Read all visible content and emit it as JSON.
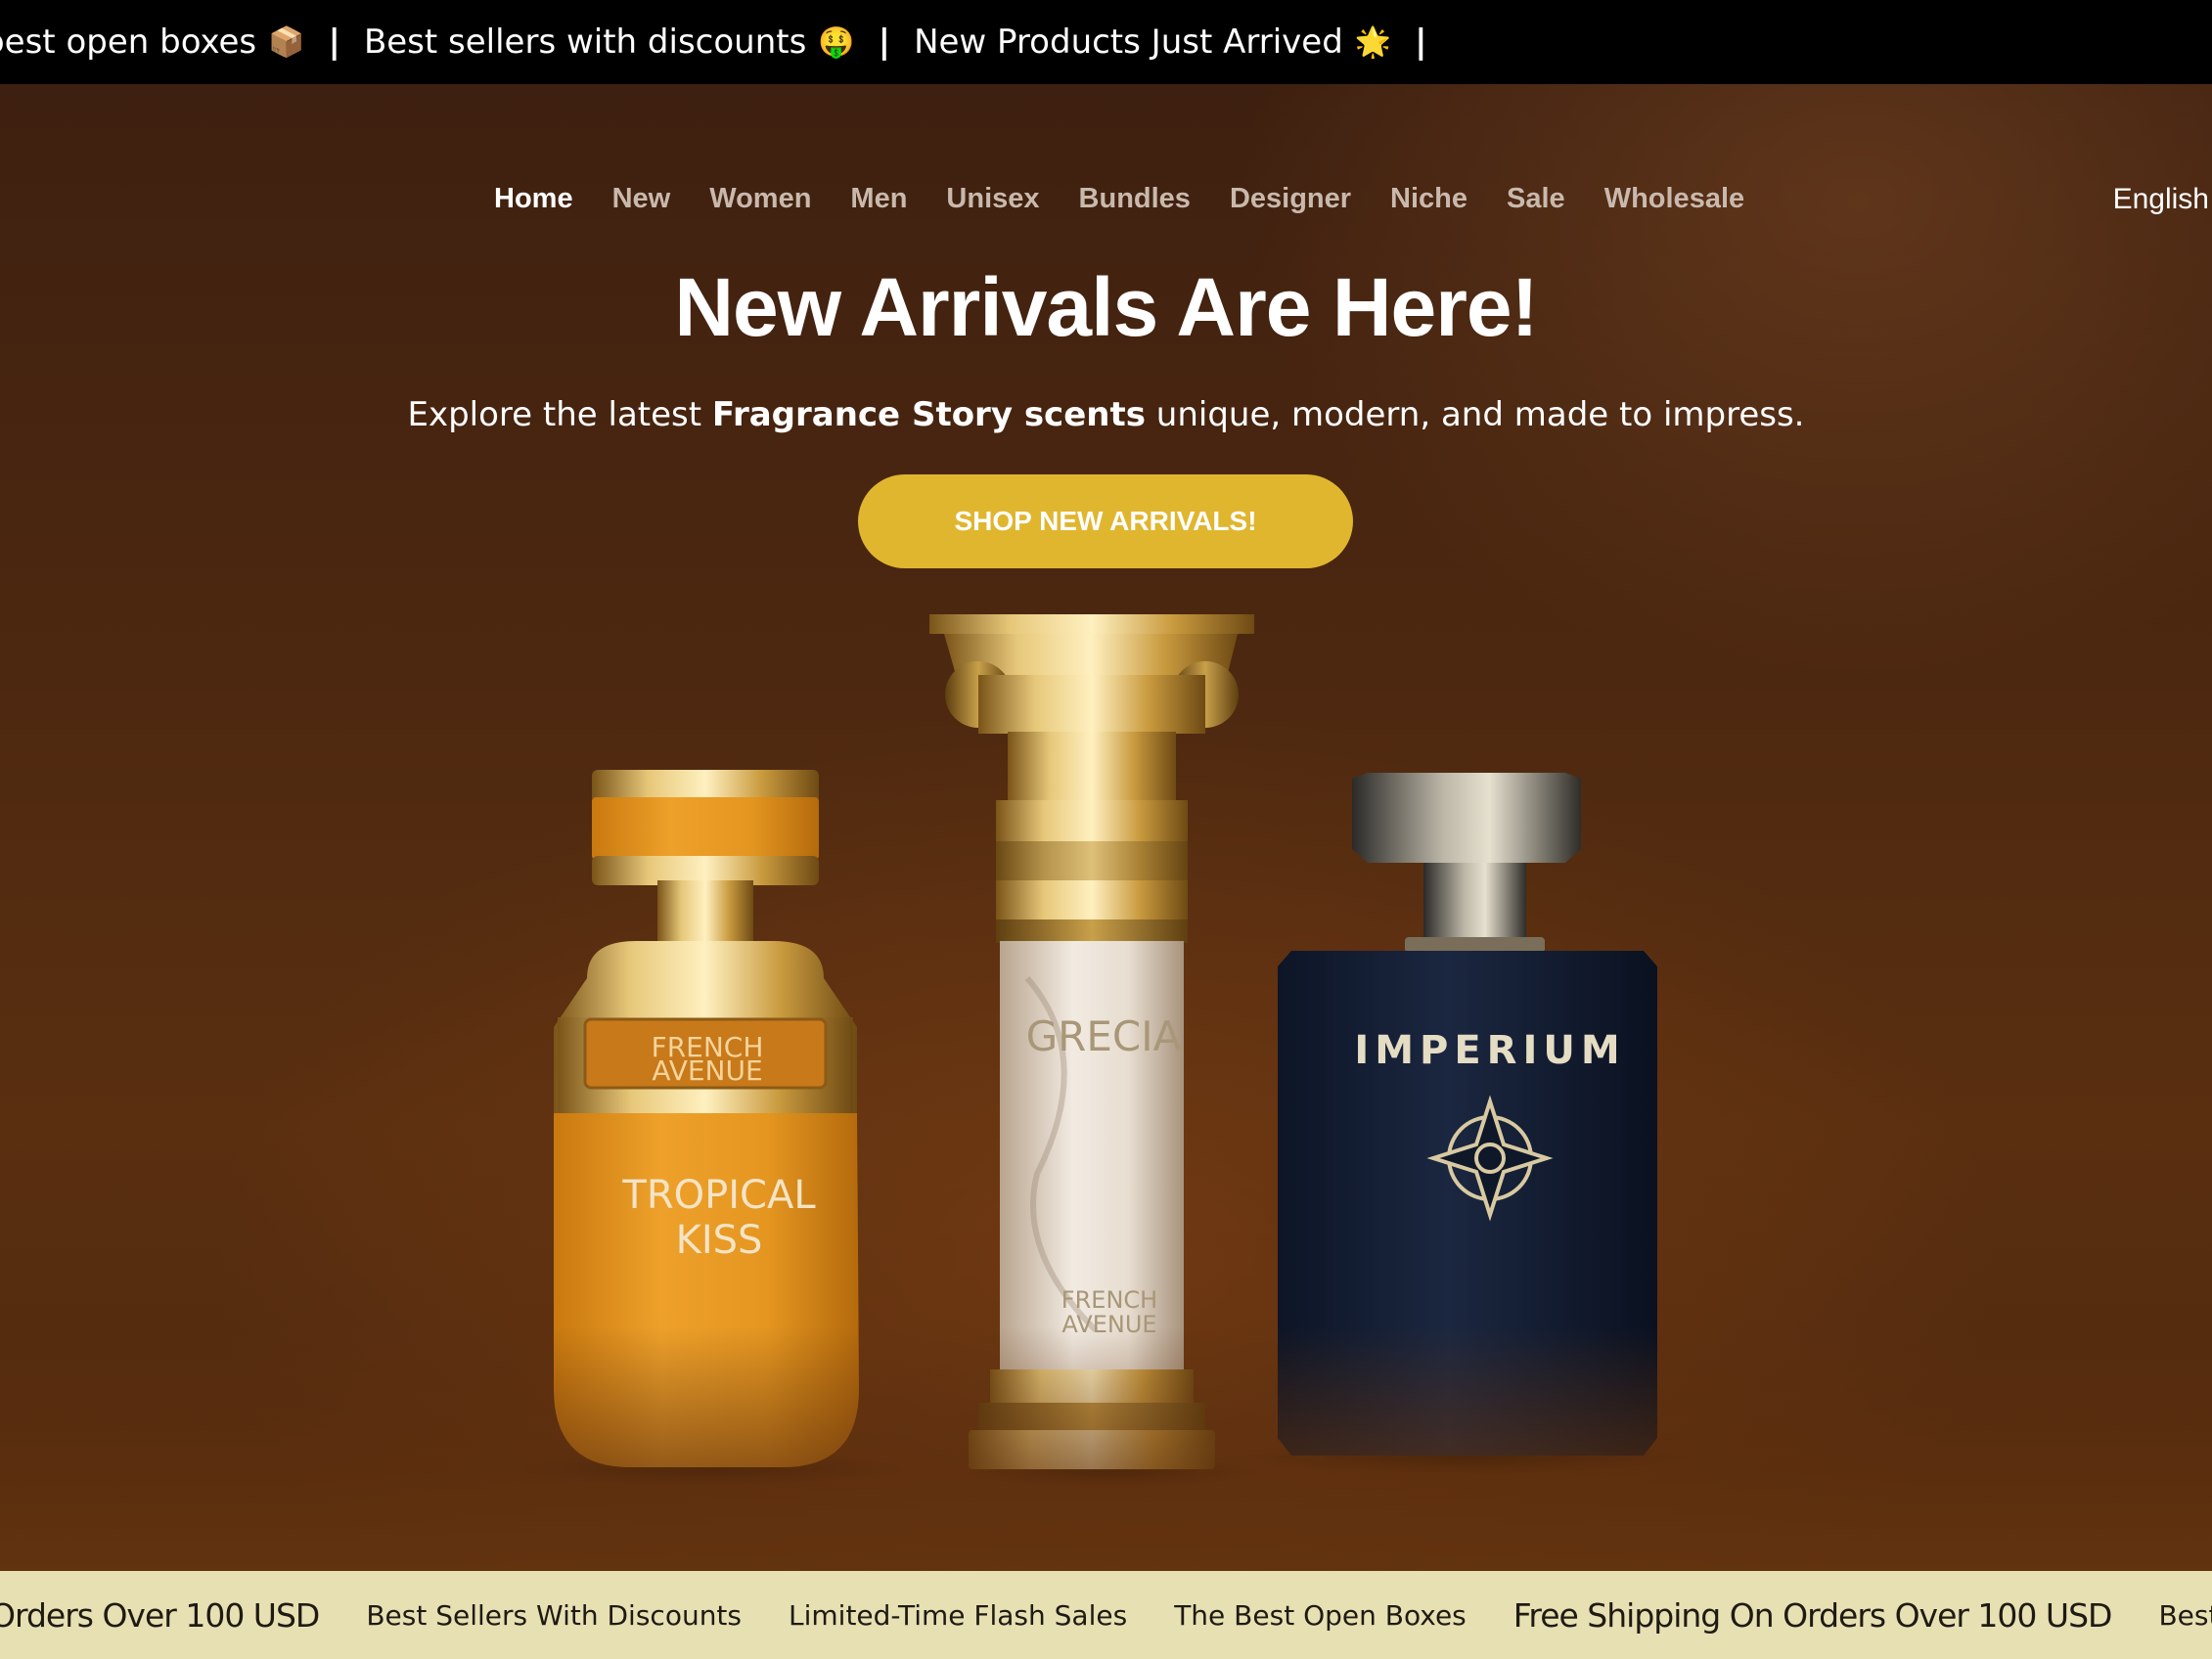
{
  "announcement_bar": {
    "items": [
      {
        "text": "ɔest open boxes",
        "emoji": "📦"
      },
      {
        "text": "Best sellers with discounts",
        "emoji": "🤑"
      },
      {
        "text": "New Products Just Arrived",
        "emoji": "🌟"
      }
    ],
    "separator": "|"
  },
  "nav": {
    "items": [
      "Home",
      "New",
      "Women",
      "Men",
      "Unisex",
      "Bundles",
      "Designer",
      "Niche",
      "Sale",
      "Wholesale"
    ],
    "active": "Home",
    "language": "English"
  },
  "hero": {
    "title": "New Arrivals Are Here!",
    "subtitle_prefix": "Explore the latest ",
    "subtitle_bold": "Fragrance Story scents",
    "subtitle_suffix": " unique, modern, and made to impress.",
    "cta_label": "SHOP NEW ARRIVALS!"
  },
  "products": [
    {
      "brand_line1": "FRENCH",
      "brand_line2": "AVENUE",
      "name_line1": "TROPICAL",
      "name_line2": "KISS"
    },
    {
      "name": "GRECIA",
      "brand_line1": "FRENCH",
      "brand_line2": "AVENUE"
    },
    {
      "name": "IMPERIUM"
    }
  ],
  "bottom_bar": {
    "items": [
      {
        "text": "Orders Over 100 USD",
        "size": "big"
      },
      {
        "text": "Best Sellers With Discounts",
        "size": "small"
      },
      {
        "text": "Limited-Time Flash Sales",
        "size": "small"
      },
      {
        "text": "The Best Open Boxes",
        "size": "small"
      },
      {
        "text": "Free Shipping On Orders Over 100 USD",
        "size": "big"
      },
      {
        "text": "Best Sellers With D",
        "size": "small"
      }
    ]
  },
  "colors": {
    "cta": "#e0b62f",
    "bottom_bar": "#e6e0b3",
    "top_bar": "#000000"
  }
}
